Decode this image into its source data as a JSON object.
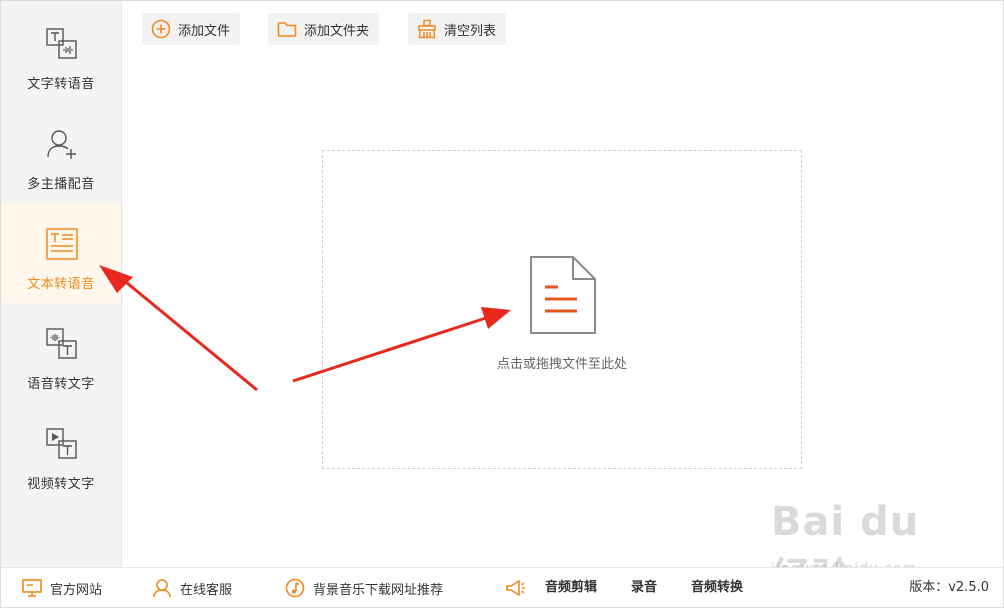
{
  "sidebar": {
    "items": [
      {
        "label": "文字转语音",
        "icon": "text-to-speech-icon",
        "active": false
      },
      {
        "label": "多主播配音",
        "icon": "add-user-icon",
        "active": false
      },
      {
        "label": "文本转语音",
        "icon": "document-text-icon",
        "active": true
      },
      {
        "label": "语音转文字",
        "icon": "speech-to-text-icon",
        "active": false
      },
      {
        "label": "视频转文字",
        "icon": "video-to-text-icon",
        "active": false
      }
    ]
  },
  "toolbar": {
    "add_file_label": "添加文件",
    "add_folder_label": "添加文件夹",
    "clear_list_label": "清空列表"
  },
  "dropzone": {
    "hint": "点击或拖拽文件至此处"
  },
  "footer": {
    "website_label": "官方网站",
    "support_label": "在线客服",
    "bgm_label": "背景音乐下载网址推荐",
    "audio_edit_label": "音频剪辑",
    "record_label": "录音",
    "audio_convert_label": "音频转换",
    "version_label": "版本：v2.5.0"
  },
  "watermark": {
    "brand": "Bai du 经验",
    "url": "jingyan.baidu.com"
  },
  "colors": {
    "accent": "#f08a1c",
    "doc_lines": "#e8541e",
    "annotation_arrow": "#e8281e"
  }
}
